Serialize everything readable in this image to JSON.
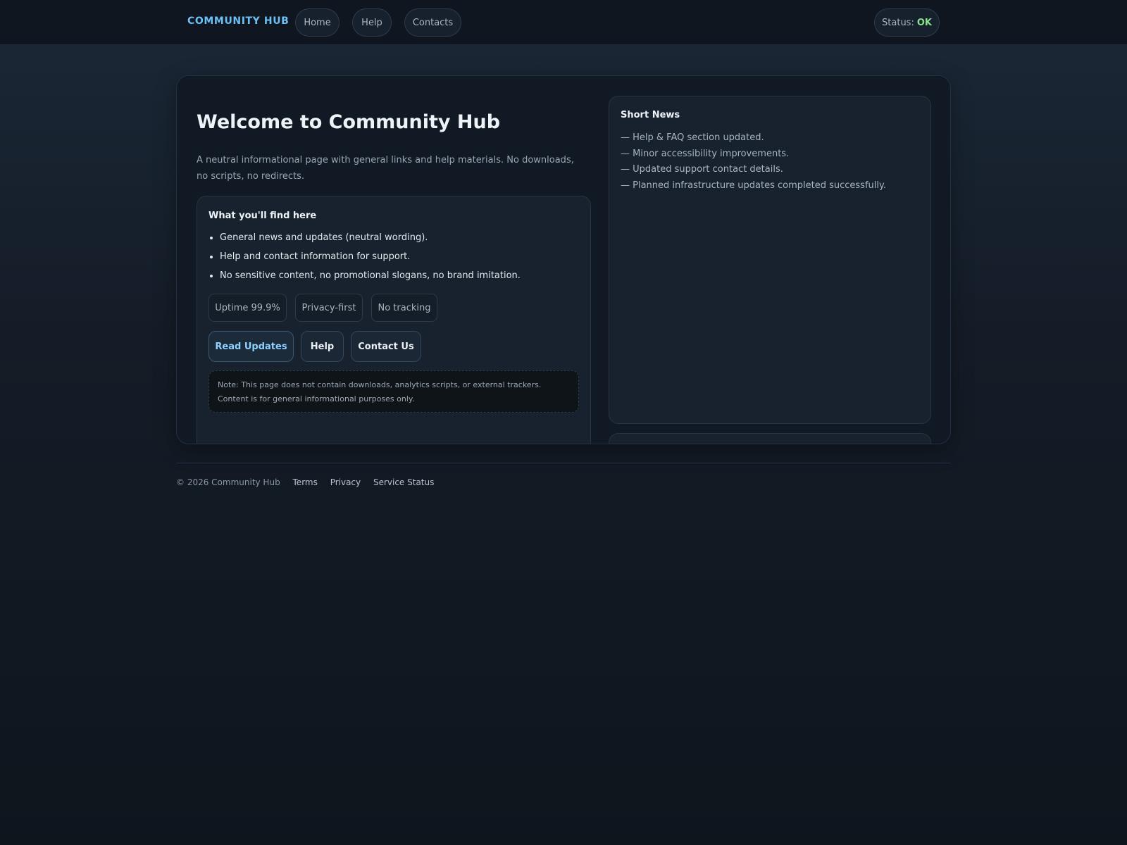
{
  "header": {
    "brand": "COMMUNITY HUB",
    "nav": [
      "Home",
      "Help",
      "Contacts"
    ],
    "status_label": "Status:",
    "status_value": "OK"
  },
  "main": {
    "title": "Welcome to Community Hub",
    "description": "A neutral informational page with general links and help materials. No downloads, no scripts, no redirects.",
    "features_title": "What you'll find here",
    "features": [
      "General news and updates (neutral wording).",
      "Help and contact information for support.",
      "No sensitive content, no promotional slogans, no brand imitation."
    ],
    "tags": [
      "Uptime 99.9%",
      "Privacy-first",
      "No tracking"
    ],
    "buttons": [
      "Read Updates",
      "Help",
      "Contact Us"
    ],
    "note": "Note: This page does not contain downloads, analytics scripts, or external trackers. Content is for general informational purposes only."
  },
  "news": {
    "title": "Short News",
    "items": [
      "— Help & FAQ section updated.",
      "— Minor accessibility improvements.",
      "— Updated support contact details.",
      "— Planned infrastructure updates completed successfully."
    ]
  },
  "footer": {
    "copyright": "© 2026 Community Hub",
    "links": [
      "Terms",
      "Privacy",
      "Service Status"
    ]
  },
  "colors": {
    "accent": "#6cc0f5",
    "status_ok": "#8be08b",
    "background": "#141c27"
  }
}
